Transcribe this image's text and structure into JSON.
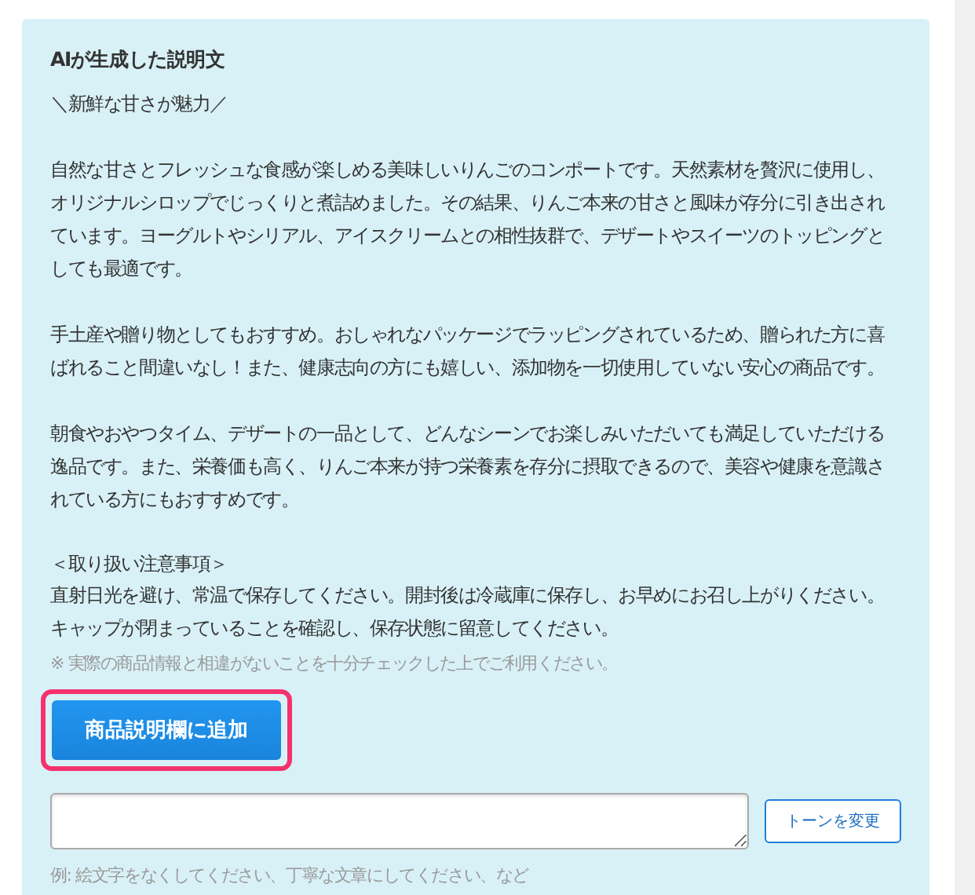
{
  "panel": {
    "title": "AIが生成した説明文",
    "paragraphs": [
      {
        "kind": "catch",
        "text": "＼新鮮な甘さが魅力／"
      },
      {
        "kind": "body",
        "text": "自然な甘さとフレッシュな食感が楽しめる美味しいりんごのコンポートです。天然素材を贅沢に使用し、オリジナルシロップでじっくりと煮詰めました。その結果、りんご本来の甘さと風味が存分に引き出されています。ヨーグルトやシリアル、アイスクリームとの相性抜群で、デザートやスイーツのトッピングとしても最適です。"
      },
      {
        "kind": "body",
        "text": "手土産や贈り物としてもおすすめ。おしゃれなパッケージでラッピングされているため、贈られた方に喜ばれること間違いなし！また、健康志向の方にも嬉しい、添加物を一切使用していない安心の商品です。"
      },
      {
        "kind": "body",
        "text": "朝食やおやつタイム、デザートの一品として、どんなシーンでお楽しみいただいても満足していただける逸品です。また、栄養価も高く、りんご本来が持つ栄養素を存分に摂取できるので、美容や健康を意識されている方にもおすすめです。"
      },
      {
        "kind": "note-heading",
        "text": "＜取り扱い注意事項＞"
      },
      {
        "kind": "note",
        "text": "直射日光を避け、常温で保存してください。開封後は冷蔵庫に保存し、お早めにお召し上がりください。キャップが閉まっていることを確認し、保存状態に留意してください。"
      }
    ],
    "disclaimer": "※ 実際の商品情報と相違がないことを十分チェックした上でご利用ください。",
    "add_button": {
      "label": "商品説明欄に追加",
      "highlighted": true
    },
    "tone_button": {
      "label": "トーンを変更"
    },
    "hint": "例: 絵文字をなくしてください、丁寧な文章にしてください、など"
  }
}
